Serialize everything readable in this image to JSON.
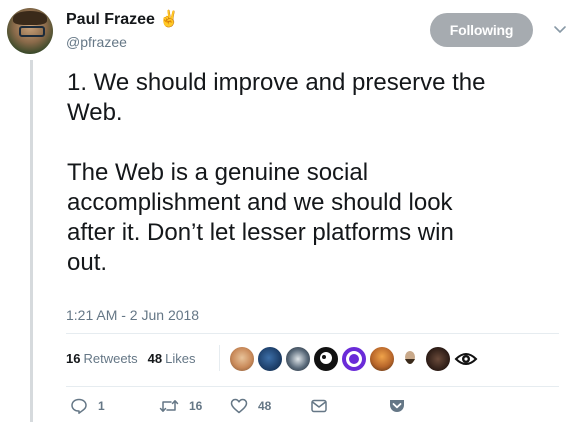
{
  "author": {
    "name": "Paul Frazee",
    "emoji": "✌",
    "handle": "@pfrazee"
  },
  "follow_button": {
    "label": "Following"
  },
  "tweet": {
    "text": "1. We should improve and preserve the\nWeb.\n\nThe Web is a genuine social\naccomplishment and we should look\nafter it. Don’t let lesser platforms win\nout.",
    "timestamp": "1:21 AM - 2 Jun 2018"
  },
  "stats": {
    "retweets_count": "16",
    "retweets_label": "Retweets",
    "likes_count": "48",
    "likes_label": "Likes"
  },
  "likers": [
    {
      "icon": "avatar-face-tan"
    },
    {
      "icon": "avatar-blue-globe"
    },
    {
      "icon": "avatar-cartoon"
    },
    {
      "icon": "avatar-black-bird"
    },
    {
      "icon": "avatar-purple-ring"
    },
    {
      "icon": "avatar-orange-figure"
    },
    {
      "icon": "avatar-bearded-man"
    },
    {
      "icon": "avatar-dark-photo"
    },
    {
      "icon": "avatar-eye-logo"
    }
  ],
  "actions": {
    "reply_count": "1",
    "retweet_count": "16",
    "like_count": "48"
  },
  "colors": {
    "follow_button_bg": "#a6abb0",
    "secondary_text": "#657786",
    "primary_text": "#14171a",
    "thread_line": "#d6dadd"
  }
}
